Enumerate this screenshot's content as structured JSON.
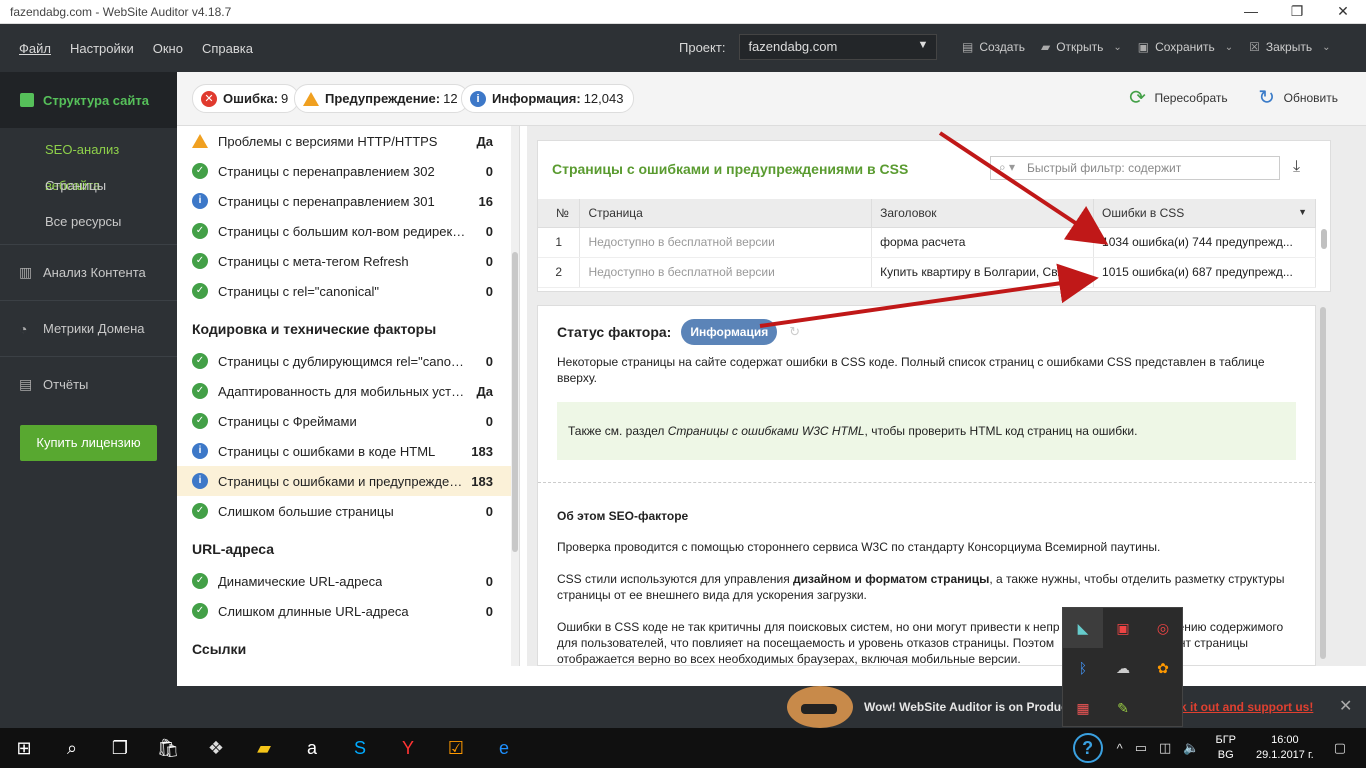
{
  "window": {
    "title": "fazendabg.com - WebSite Auditor v4.18.7",
    "controls": [
      "—",
      "❐",
      "✕"
    ]
  },
  "menu": {
    "items": [
      "Файл",
      "Настройки",
      "Окно",
      "Справка"
    ],
    "project_label": "Проект:",
    "project_value": "fazendabg.com",
    "actions": [
      {
        "label": "Создать",
        "icon": "file-icon"
      },
      {
        "label": "Открыть",
        "icon": "folder-icon"
      },
      {
        "label": "Сохранить",
        "icon": "save-icon"
      },
      {
        "label": "Закрыть",
        "icon": "close-icon"
      }
    ]
  },
  "nav": {
    "main": "Структура сайта",
    "subs": [
      "SEO-анализ вебсайта",
      "Страницы",
      "Все ресурсы"
    ],
    "sections": [
      {
        "label": "Анализ Контента",
        "icon": "content-icon"
      },
      {
        "label": "Метрики Домена",
        "icon": "gauge-icon"
      },
      {
        "label": "Отчёты",
        "icon": "report-icon"
      }
    ],
    "buy": "Купить лицензию"
  },
  "summary": {
    "errors_label": "Ошибка:",
    "errors_count": "9",
    "warnings_label": "Предупреждение:",
    "warnings_count": "12",
    "info_label": "Информация:",
    "info_count": "12,043",
    "rebuild": "Пересобрать",
    "update": "Обновить"
  },
  "factors": {
    "group1": [
      {
        "label": "Проблемы с версиями HTTP/HTTPS",
        "value": "Да",
        "status": "warn"
      },
      {
        "label": "Страницы с перенаправлением 302",
        "value": "0",
        "status": "ok"
      },
      {
        "label": "Страницы с перенаправлением 301",
        "value": "16",
        "status": "info"
      },
      {
        "label": "Страницы с большим кол-вом редиректов",
        "value": "0",
        "status": "ok"
      },
      {
        "label": "Страницы с мета-тегом Refresh",
        "value": "0",
        "status": "ok"
      },
      {
        "label": "Страницы с rel=\"canonical\"",
        "value": "0",
        "status": "ok"
      }
    ],
    "group2_title": "Кодировка и технические факторы",
    "group2": [
      {
        "label": "Страницы с дублирующимся rel=\"canonical\"",
        "value": "0",
        "status": "ok"
      },
      {
        "label": "Адаптированность для мобильных устройств",
        "value": "Да",
        "status": "ok"
      },
      {
        "label": "Страницы с Фреймами",
        "value": "0",
        "status": "ok"
      },
      {
        "label": "Страницы с ошибками в коде HTML",
        "value": "183",
        "status": "info"
      },
      {
        "label": "Страницы с ошибками и предупреждения...",
        "value": "183",
        "status": "info"
      },
      {
        "label": "Слишком большие страницы",
        "value": "0",
        "status": "ok"
      }
    ],
    "group3_title": "URL-адреса",
    "group3": [
      {
        "label": "Динамические URL-адреса",
        "value": "0",
        "status": "ok"
      },
      {
        "label": "Слишком длинные URL-адреса",
        "value": "0",
        "status": "ok"
      }
    ],
    "group4_title": "Ссылки"
  },
  "table": {
    "title": "Страницы с ошибками и предупреждениями в  CSS",
    "filter_placeholder": "Быстрый фильтр: содержит",
    "columns": [
      "№",
      "Страница",
      "Заголовок",
      "Ошибки в CSS"
    ],
    "rows": [
      {
        "num": "1",
        "page": "Недоступно в бесплатной версии",
        "title": "форма расчета",
        "errors": "1034 ошибка(и) 744 предупрежд..."
      },
      {
        "num": "2",
        "page": "Недоступно в бесплатной версии",
        "title": "Купить квартиру в Болгарии, Свят...",
        "errors": "1015 ошибка(и) 687 предупрежд..."
      }
    ]
  },
  "detail": {
    "status_label": "Статус фактора:",
    "status_badge": "Информация",
    "intro": "Некоторые страницы на сайте содержат ошибки в CSS коде. Полный список страниц с ошибками CSS представлен в таблице вверху.",
    "box_pre": "Также см. раздел ",
    "box_em": "Страницы с ошибками W3C HTML",
    "box_post": ", чтобы проверить HTML код страниц на ошибки.",
    "about_title": "Об этом SEO-факторе",
    "p1": "Проверка проводится с помощью стороннего сервиса W3C по стандарту Консорциума Всемирной паутины.",
    "p2_pre": "CSS стили используются для управления ",
    "p2_b": "дизайном и форматом страницы",
    "p2_post": ", а также нужны, чтобы отделить разметку структуры страницы от ее внешнего вида для ускорения загрузки.",
    "p3": "Ошибки в CSS коде не так критичны для поисковых систем, но они могут привести к непр",
    "p3_tail": "ению содержимого",
    "p3b": "для пользователей, что повлияет на посещаемость и уровень отказов страницы. Поэтом",
    "p3b_tail": "ент страницы",
    "p3c": "отображается верно во всех необходимых браузерах, включая мобильные версии."
  },
  "notification": {
    "message": "Wow! WebSite Auditor is on Produc",
    "link": "k it out and support us!"
  },
  "taskbar": {
    "lang_top": "БГР",
    "lang_bottom": "BG",
    "time": "16:00",
    "date": "29.1.2017 г."
  },
  "colors": {
    "accent_green": "#56c05a",
    "dark_bg": "#2d3135",
    "error_red": "#e03a2e",
    "warn_orange": "#f0a020",
    "info_blue": "#3d78c8",
    "annotation_red": "#c01818"
  }
}
